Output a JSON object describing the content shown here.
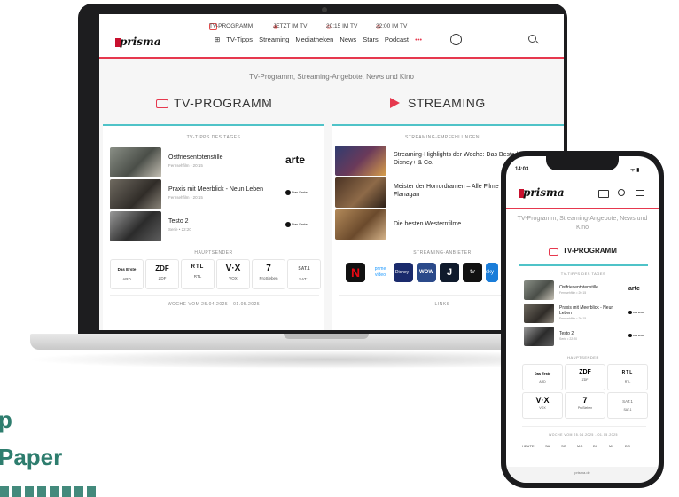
{
  "header": {
    "top_links": [
      "TV-PROGRAMM",
      "JETZT IM TV",
      "20:15 IM TV",
      "22:00 IM TV"
    ],
    "logo": "prisma",
    "nav": [
      "TV-Tipps",
      "Streaming",
      "Mediatheken",
      "News",
      "Stars",
      "Podcast",
      "•••"
    ]
  },
  "tagline": "TV-Programm, Streaming-Angebote, News und Kino",
  "tv": {
    "title": "TV-PROGRAMM",
    "chevron": "›",
    "tipps_label": "TV-TIPPS DES TAGES",
    "items": [
      {
        "title": "Ostfriesentotenstille",
        "sub": "Fernsehfilm • 20:15",
        "channel": "arte"
      },
      {
        "title": "Praxis mit Meerblick - Neun Leben",
        "sub": "Fernsehfilm • 20:15",
        "channel": "Das Erste"
      },
      {
        "title": "Testo 2",
        "sub": "Serie • 22:20",
        "channel": "Das Erste"
      }
    ],
    "sender_label": "HAUPTSENDER",
    "senders": [
      {
        "logo": "Das Erste",
        "name": "ARD"
      },
      {
        "logo": "ZDF",
        "name": "ZDF"
      },
      {
        "logo": "RTL",
        "name": "RTL"
      },
      {
        "logo": "V·X",
        "name": "VOX"
      },
      {
        "logo": "7",
        "name": "ProSieben"
      },
      {
        "logo": "SAT.1",
        "name": "SAT.1"
      }
    ],
    "week": "WOCHE VOM 25.04.2025 - 01.05.2025"
  },
  "streaming": {
    "title": "STREAMING",
    "chevron": "›",
    "label": "STREAMING-EMPFEHLUNGEN",
    "items": [
      {
        "title": "Streaming-Highlights der Woche: Das Beste bei Netflix, Disney+ & Co."
      },
      {
        "title": "Meister der Horrordramen – Alle Filme und Serien von Mike Flanagan"
      },
      {
        "title": "Die besten Westernfilme"
      }
    ],
    "anbieter_label": "STREAMING-ANBIETER",
    "apps": [
      "N",
      "prime video",
      "Disney+",
      "WOW",
      "J",
      "tv",
      "sky"
    ],
    "links_label": "LINKS"
  },
  "phone": {
    "time": "14:03",
    "logo": "prisma",
    "tagline": "TV-Programm, Streaming-Angebote, News und Kino",
    "title": "TV-PROGRAMM",
    "tipps_label": "TV-TIPPS DES TAGES",
    "items": [
      {
        "title": "Ostfriesentotenstille",
        "sub": "Fernsehfilm • 20:15",
        "channel": "arte"
      },
      {
        "title": "Praxis mit Meerblick - Neun Leben",
        "sub": "Fernsehfilm • 20:15",
        "channel": "Das Erste"
      },
      {
        "title": "Testo 2",
        "sub": "Serie • 22:20",
        "channel": "Das Erste"
      }
    ],
    "sender_label": "HAUPTSENDER",
    "senders": [
      {
        "logo": "Das Erste",
        "name": "ARD"
      },
      {
        "logo": "ZDF",
        "name": "ZDF"
      },
      {
        "logo": "RTL",
        "name": "RTL"
      },
      {
        "logo": "V·X",
        "name": "VOX"
      },
      {
        "logo": "7",
        "name": "ProSieben"
      },
      {
        "logo": "SAT.1",
        "name": "SAT.1"
      }
    ],
    "week": "WOCHE VOM 25.04.2025 - 01.05.2025",
    "days": [
      "HEUTE",
      "SA",
      "SO",
      "MO",
      "DI",
      "MI",
      "DO"
    ],
    "footer": "prisma.de"
  },
  "side_text": [
    "p",
    "Paper"
  ],
  "colors": {
    "accent_red": "#e6384e",
    "teal": "#4fc3c8",
    "brand_red": "#c8102e",
    "side_green": "#2e7d6e"
  }
}
